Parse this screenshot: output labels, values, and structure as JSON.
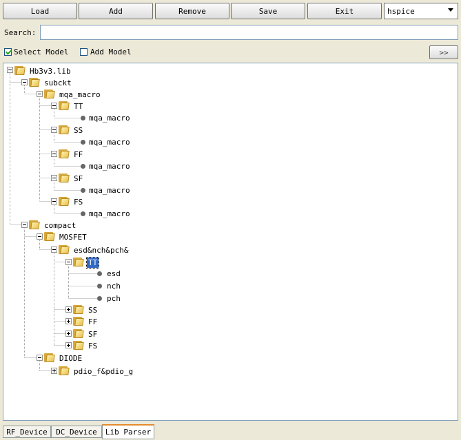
{
  "toolbar": {
    "load": "Load",
    "add": "Add",
    "remove": "Remove",
    "save": "Save",
    "exit": "Exit",
    "simulator": "hspice"
  },
  "search": {
    "label": "Search:",
    "value": ""
  },
  "options": {
    "select_model": "Select Model",
    "select_model_checked": true,
    "add_model": "Add Model",
    "add_model_checked": false,
    "next_button": ">>"
  },
  "tree": {
    "root": "Hb3v3.lib",
    "subckt": "subckt",
    "mqa_macro": "mqa_macro",
    "corners": [
      "TT",
      "SS",
      "FF",
      "SF",
      "FS"
    ],
    "leaf_mqa": "mqa_macro",
    "compact": "compact",
    "mosfet": "MOSFET",
    "esd_group": "esd&nch&pch&",
    "tt_selected": "TT",
    "tt_leaves": [
      "esd",
      "nch",
      "pch"
    ],
    "esd_corners": [
      "SS",
      "FF",
      "SF",
      "FS"
    ],
    "diode": "DIODE",
    "diode_child": "pdio_f&pdio_g"
  },
  "tabs": [
    "RF_Device",
    "DC_Device",
    "Lib Parser"
  ],
  "active_tab": "Lib Parser",
  "colors": {
    "selection": "#316ac5",
    "folder": "#e8c050",
    "background": "#ece9d8"
  }
}
